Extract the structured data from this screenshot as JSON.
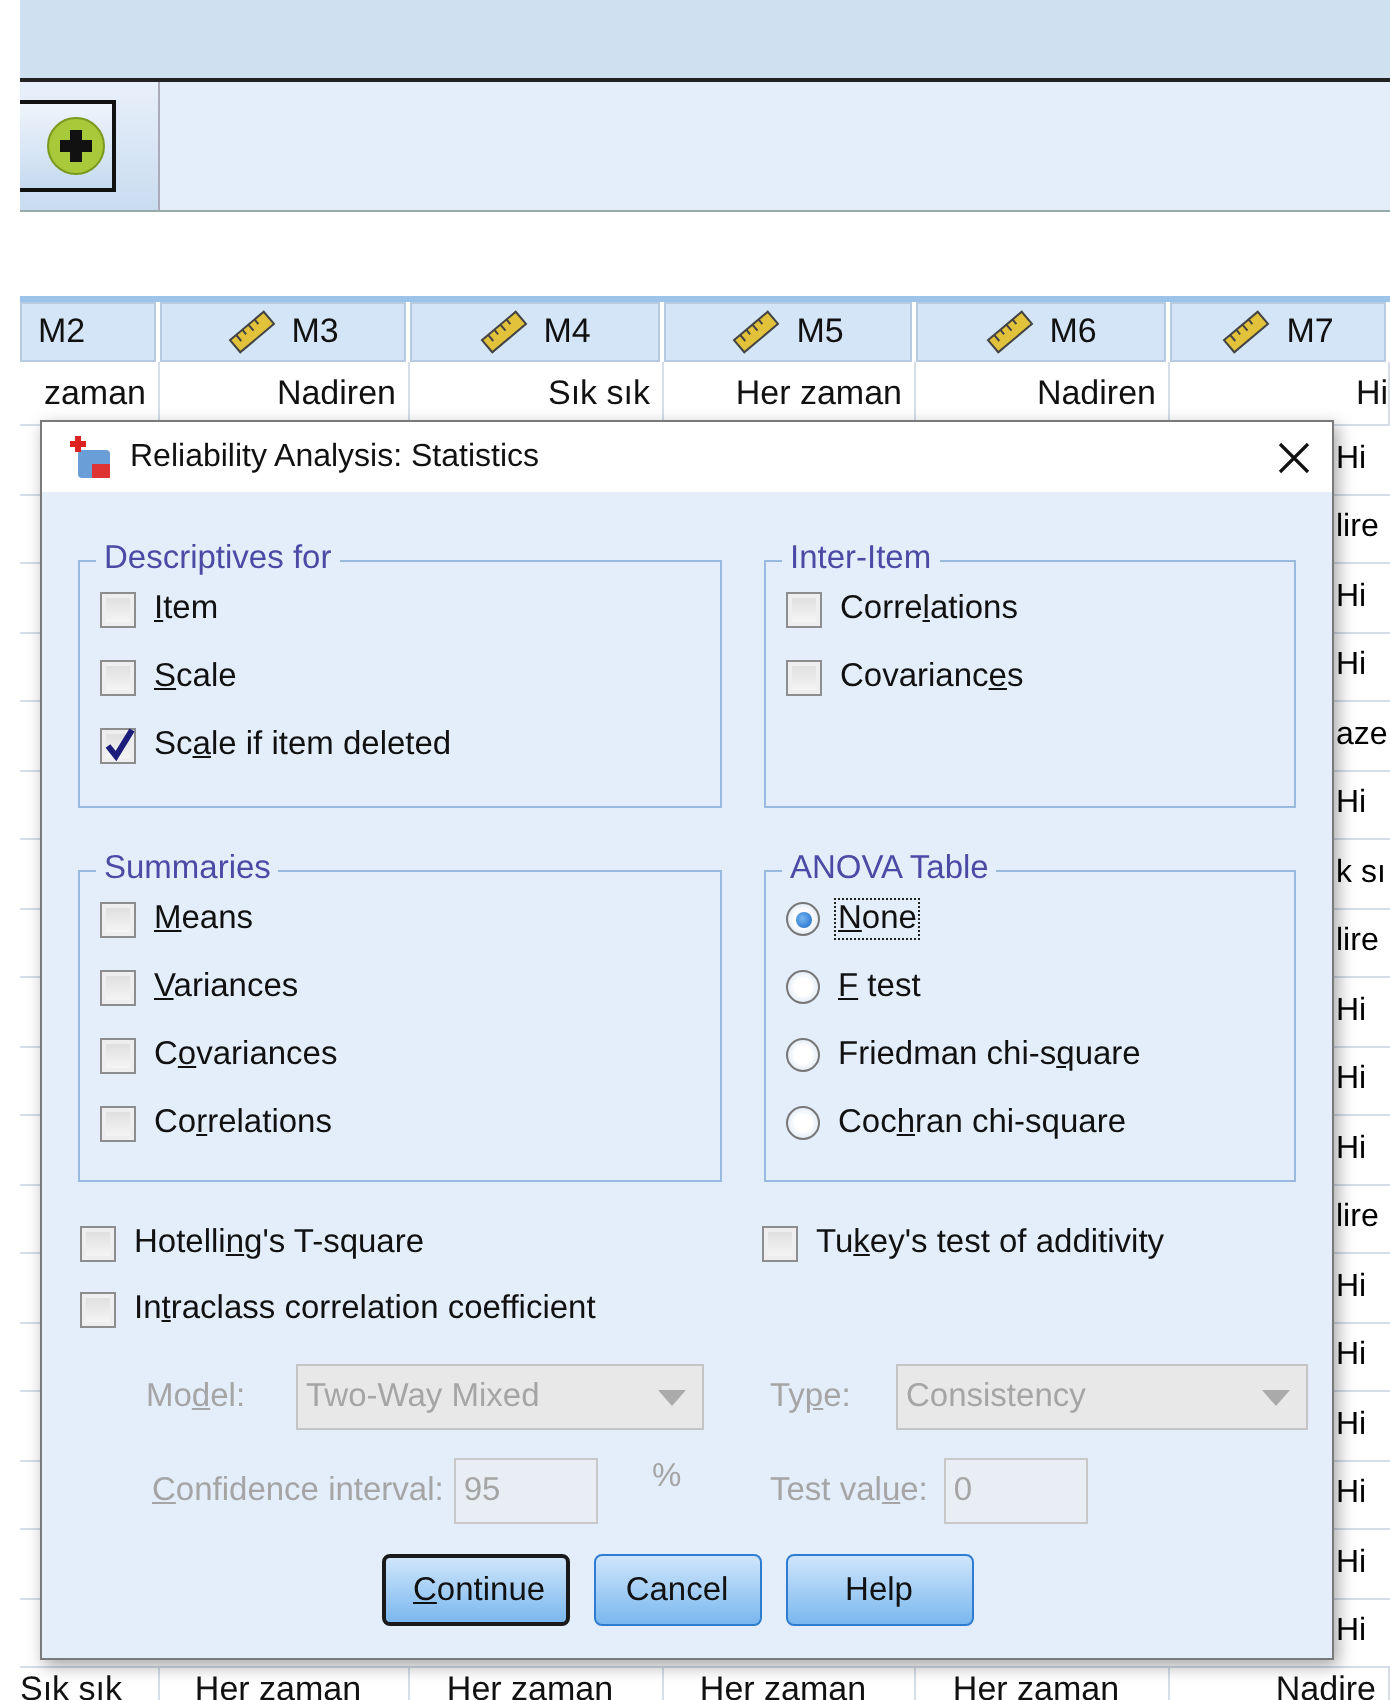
{
  "grid": {
    "columns": [
      "M2",
      "M3",
      "M4",
      "M5",
      "M6",
      "M7"
    ],
    "first_row": [
      "zaman",
      "Nadiren",
      "Sık sık",
      "Her zaman",
      "Nadiren",
      "Hi"
    ],
    "edge_cells": [
      "Hi",
      "lire",
      "Hi",
      "Hi",
      "aze",
      "Hi",
      "k sı",
      "lire",
      "Hi",
      "Hi",
      "Hi",
      "lire",
      "Hi",
      "Hi",
      "Hi",
      "Hi",
      "Hi",
      "Hi"
    ],
    "last_row": [
      "Sık sık",
      "Her zaman",
      "Her zaman",
      "Her zaman",
      "Her zaman",
      "Nadire"
    ]
  },
  "dialog": {
    "title": "Reliability Analysis: Statistics",
    "groups": [
      {
        "legend": "Descriptives for",
        "kind": "check",
        "items": [
          {
            "label": {
              "key": "I",
              "post": "tem"
            },
            "checked": false
          },
          {
            "label": {
              "key": "S",
              "post": "cale"
            },
            "checked": false
          },
          {
            "label": {
              "pre": "Sc",
              "key": "a",
              "post": "le if item deleted"
            },
            "checked": true
          }
        ]
      },
      {
        "legend": "Inter-Item",
        "kind": "check",
        "items": [
          {
            "label": {
              "pre": "Corre",
              "key": "l",
              "post": "ations"
            },
            "checked": false
          },
          {
            "label": {
              "pre": "Covarianc",
              "key": "e",
              "post": "s"
            },
            "checked": false
          }
        ]
      },
      {
        "legend": "Summaries",
        "kind": "check",
        "items": [
          {
            "label": {
              "key": "M",
              "post": "eans"
            },
            "checked": false
          },
          {
            "label": {
              "key": "V",
              "post": "ariances"
            },
            "checked": false
          },
          {
            "label": {
              "pre": "C",
              "key": "o",
              "post": "variances"
            },
            "checked": false
          },
          {
            "label": {
              "pre": "Co",
              "key": "r",
              "post": "relations"
            },
            "checked": false
          }
        ]
      },
      {
        "legend": "ANOVA Table",
        "kind": "radio",
        "items": [
          {
            "label": {
              "key": "N",
              "post": "one"
            },
            "selected": true
          },
          {
            "label": {
              "key": "F",
              "post": " test"
            },
            "selected": false
          },
          {
            "label": {
              "pre": "Friedman chi-s",
              "key": "q",
              "post": "uare"
            },
            "selected": false
          },
          {
            "label": {
              "pre": "Coc",
              "key": "h",
              "post": "ran chi-square"
            },
            "selected": false
          }
        ]
      }
    ],
    "options": [
      {
        "label": {
          "pre": "Hotelli",
          "key": "n",
          "post": "g's T-square"
        },
        "checked": false
      },
      {
        "label": {
          "pre": "Tu",
          "key": "k",
          "post": "ey's test of additivity"
        },
        "checked": false
      },
      {
        "label": {
          "pre": "In",
          "key": "t",
          "post": "raclass correlation coefficient"
        },
        "checked": false
      }
    ],
    "icc": {
      "disabled": true,
      "model": {
        "label": {
          "pre": "Mo",
          "key": "d",
          "post": "el:"
        },
        "value": "Two-Way Mixed"
      },
      "type": {
        "label": {
          "pre": "Ty",
          "key": "p",
          "post": "e:"
        },
        "value": "Consistency"
      },
      "confidence": {
        "label": {
          "key": "C",
          "post": "onfidence interval:"
        },
        "value": "95",
        "unit": "%"
      },
      "test_value": {
        "label": {
          "pre": "Test val",
          "key": "u",
          "post": "e:"
        },
        "value": "0"
      }
    },
    "buttons": [
      {
        "label": {
          "key": "C",
          "post": "ontinue"
        },
        "default": true
      },
      {
        "label": {
          "pre": "Cancel"
        },
        "default": false
      },
      {
        "label": {
          "pre": "Help"
        },
        "default": false
      }
    ]
  }
}
